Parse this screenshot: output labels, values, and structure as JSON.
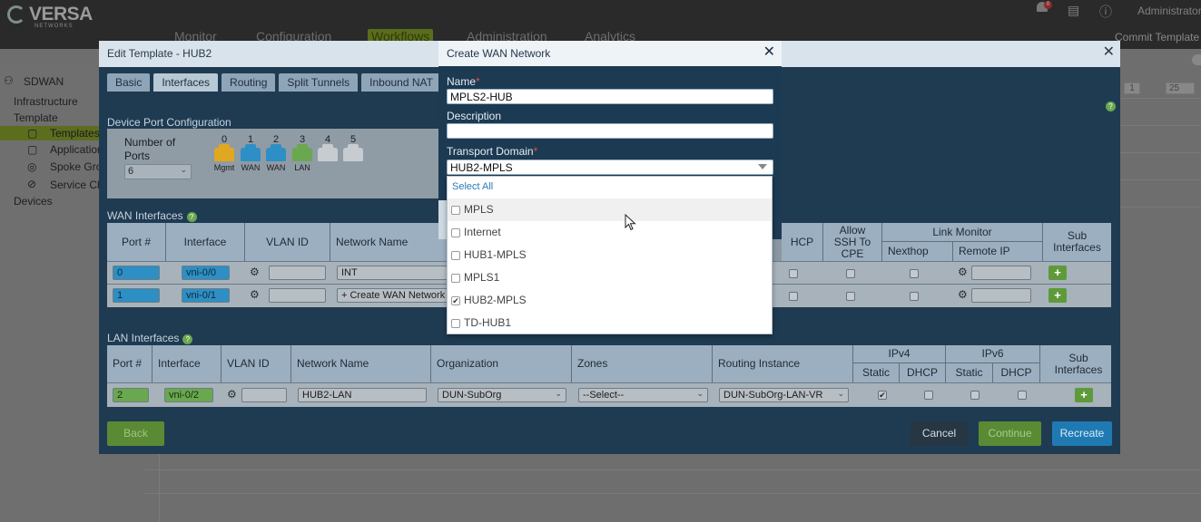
{
  "app": {
    "logo": "VERSA",
    "logo_sub": "NETWORKS",
    "nav": [
      "Monitor",
      "Configuration",
      "Workflows",
      "Administration",
      "Analytics"
    ],
    "notification_count": "0",
    "user": "Administrator",
    "commit_label": "Commit Template",
    "pager": {
      "page": "1",
      "per_page": "25"
    }
  },
  "left_pane": {
    "root": "SDWAN",
    "items": [
      "Infrastructure",
      "Template",
      "Templates",
      "Application",
      "Spoke Gro",
      "Service Cha",
      "Devices"
    ]
  },
  "edit_modal": {
    "title": "Edit Template - HUB2",
    "tabs": [
      "Basic",
      "Interfaces",
      "Routing",
      "Split Tunnels",
      "Inbound NAT"
    ],
    "active_tab": "Interfaces",
    "device_port_config_label": "Device Port Configuration",
    "number_of_ports_label": "Number of Ports",
    "number_of_ports_value": "6",
    "ports": [
      {
        "num": "0",
        "label": "Mgmt",
        "color": "#e0a820"
      },
      {
        "num": "1",
        "label": "WAN",
        "color": "#2e8fc6"
      },
      {
        "num": "2",
        "label": "WAN",
        "color": "#2e8fc6"
      },
      {
        "num": "3",
        "label": "LAN",
        "color": "#6aa84f"
      },
      {
        "num": "4",
        "label": "",
        "color": "#c7ccd0"
      },
      {
        "num": "5",
        "label": "",
        "color": "#c7ccd0"
      }
    ],
    "wan_interfaces_label": "WAN Interfaces",
    "wan_headers": {
      "port": "Port #",
      "interface": "Interface",
      "vlan": "VLAN ID",
      "network": "Network Name",
      "dhcp": "HCP",
      "allow_ssh": "Allow SSH To CPE",
      "link_monitor": "Link Monitor",
      "nexthop": "Nexthop",
      "remote_ip": "Remote IP",
      "sub_interfaces": "Sub Interfaces"
    },
    "wan_rows": [
      {
        "port": "0",
        "interface": "vni-0/0",
        "network": "INT"
      },
      {
        "port": "1",
        "interface": "vni-0/1",
        "network": "+ Create WAN Network"
      }
    ],
    "lan_interfaces_label": "LAN Interfaces",
    "lan_headers": {
      "port": "Port #",
      "interface": "Interface",
      "vlan": "VLAN ID",
      "network": "Network Name",
      "organization": "Organization",
      "zones": "Zones",
      "routing_instance": "Routing Instance",
      "ipv4": "IPv4",
      "ipv6": "IPv6",
      "static": "Static",
      "dhcp": "DHCP",
      "sub_interfaces": "Sub Interfaces"
    },
    "lan_rows": [
      {
        "port": "2",
        "interface": "vni-0/2",
        "network": "HUB2-LAN",
        "organization": "DUN-SubOrg",
        "zones": "--Select--",
        "routing_instance": "DUN-SubOrg-LAN-VR",
        "ipv4_static_checked": true
      }
    ],
    "buttons": {
      "back": "Back",
      "cancel": "Cancel",
      "continue": "Continue",
      "recreate": "Recreate"
    }
  },
  "cwn_modal": {
    "title": "Create WAN Network",
    "name_label": "Name",
    "name_value": "MPLS2-HUB",
    "description_label": "Description",
    "description_value": "",
    "transport_domain_label": "Transport Domain",
    "transport_domain_value": "HUB2-MPLS",
    "select_all": "Select All",
    "options": [
      {
        "label": "MPLS",
        "checked": false
      },
      {
        "label": "Internet",
        "checked": false
      },
      {
        "label": "HUB1-MPLS",
        "checked": false
      },
      {
        "label": "MPLS1",
        "checked": false
      },
      {
        "label": "HUB2-MPLS",
        "checked": true
      },
      {
        "label": "TD-HUB1",
        "checked": false
      }
    ]
  }
}
